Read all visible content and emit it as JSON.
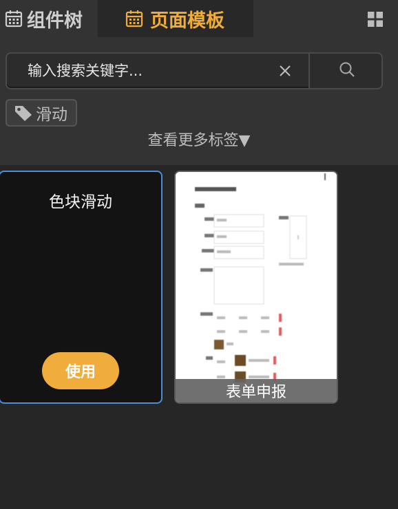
{
  "tabs": {
    "component_tree": "组件树",
    "page_template": "页面模板"
  },
  "search": {
    "placeholder": "输入搜索关键字..."
  },
  "tags": {
    "items": [
      "滑动"
    ],
    "more_label": "查看更多标签▼"
  },
  "templates": [
    {
      "title": "色块滑动",
      "use_label": "使用"
    },
    {
      "title": "表单申报"
    }
  ],
  "colors": {
    "accent": "#f0ad3c",
    "selected_border": "#4b8fd8",
    "panel_bg": "#333333",
    "page_bg": "#262626"
  },
  "icons": [
    "calendar-icon",
    "grid-view-icon",
    "clear-icon",
    "search-icon",
    "tag-icon"
  ]
}
